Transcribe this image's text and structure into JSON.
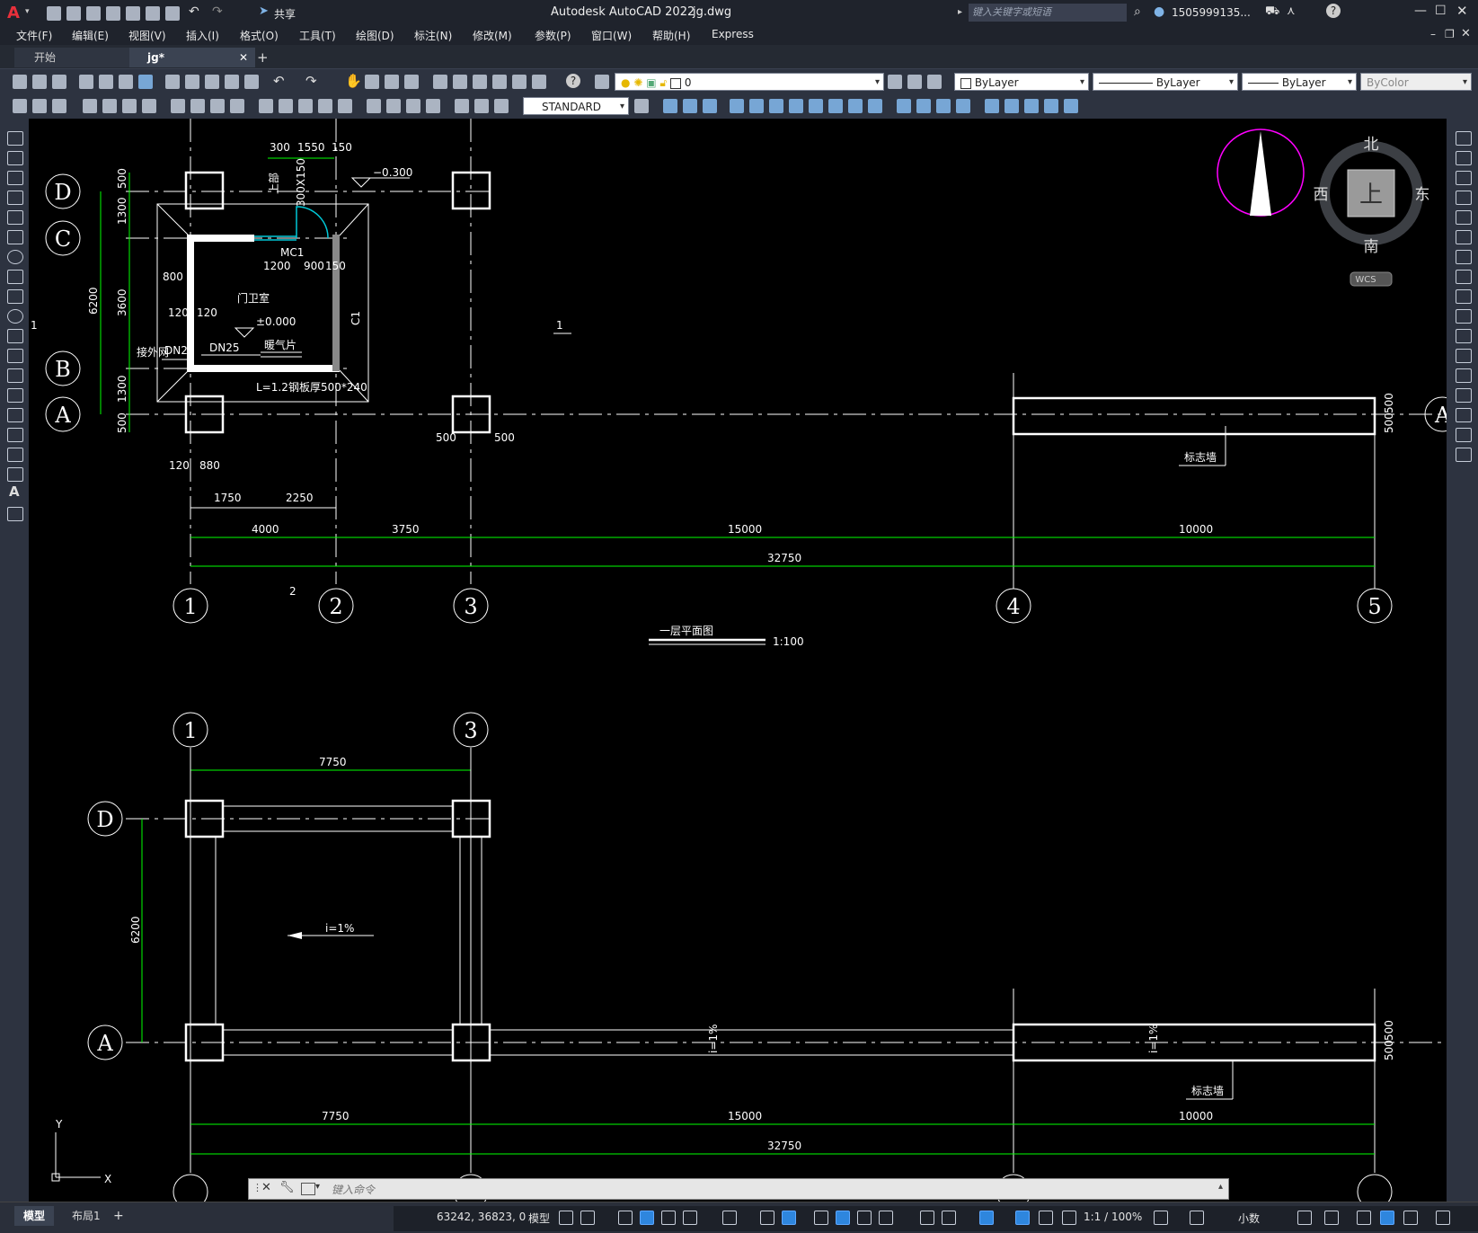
{
  "title": {
    "app": "Autodesk AutoCAD 2022",
    "file": "jg.dwg",
    "share": "共享",
    "search_placeholder": "键入关键字或短语",
    "user": "1505999135..."
  },
  "menu": [
    "文件(F)",
    "编辑(E)",
    "视图(V)",
    "插入(I)",
    "格式(O)",
    "工具(T)",
    "绘图(D)",
    "标注(N)",
    "修改(M)",
    "参数(P)",
    "窗口(W)",
    "帮助(H)",
    "Express"
  ],
  "tabs": {
    "start": "开始",
    "active": "jg*",
    "add": "+"
  },
  "toolbar": {
    "layer": "0",
    "color": "ByLayer",
    "linetype": "ByLayer",
    "lineweight": "ByLayer",
    "plotstyle": "ByColor",
    "textstyle": "STANDARD"
  },
  "viewcube": {
    "north": "北",
    "south": "南",
    "east": "东",
    "west": "西",
    "top": "上",
    "wcs": "WCS"
  },
  "drawing": {
    "plan_title": "一层平面图",
    "plan_scale": "1:100",
    "room_name": "门卫室",
    "door": "MC1",
    "window": "C1",
    "elev_out": "−0.300",
    "elev_in": "±0.000",
    "sign_wall": "标志墙",
    "slope": "i=1%",
    "gable": "上部",
    "lintel": "300X150",
    "sewer": "接外网",
    "pipe1": "DN25",
    "pipe2": "DN25",
    "radiator": "暖气片",
    "radiator_len": "L=1.2",
    "radiator_plate": "钢板厚500*240",
    "section_mark_1": "1",
    "section_mark_2": "2",
    "axes_h": [
      "1",
      "2",
      "3",
      "4",
      "5"
    ],
    "axes_v": [
      "D",
      "C",
      "B",
      "A"
    ],
    "dims_top": [
      "300",
      "1550",
      "150"
    ],
    "dims_inner": [
      "1200",
      "900",
      "150",
      "800",
      "120",
      "120"
    ],
    "dims_left": [
      "500",
      "1300",
      "3600",
      "1300",
      "500",
      "6200"
    ],
    "dims_bottom_small": [
      "120",
      "880",
      "1750",
      "2250"
    ],
    "dims_col": [
      "500",
      "500"
    ],
    "dims_row1": [
      "4000",
      "3750",
      "15000",
      "10000"
    ],
    "dims_total": "32750",
    "dims_wall": [
      "500",
      "500"
    ],
    "roof_dims_top": "7750",
    "roof_dims_left": "6200",
    "roof_dims_row": [
      "7750",
      "15000",
      "10000"
    ],
    "roof_total": "32750",
    "ucs_x": "X",
    "ucs_y": "Y"
  },
  "cmd": {
    "placeholder": "键入命令"
  },
  "layout_tabs": {
    "model": "模型",
    "layout1": "布局1",
    "add": "+"
  },
  "status": {
    "coords": "63242, 36823, 0",
    "model": "模型",
    "scale": "1:1 / 100%",
    "units": "小数"
  },
  "colors": {
    "green": "#00ff00",
    "white": "#ffffff",
    "cyan": "#00c8d8",
    "magenta": "#ff00ff",
    "accent": "#2e86de"
  }
}
